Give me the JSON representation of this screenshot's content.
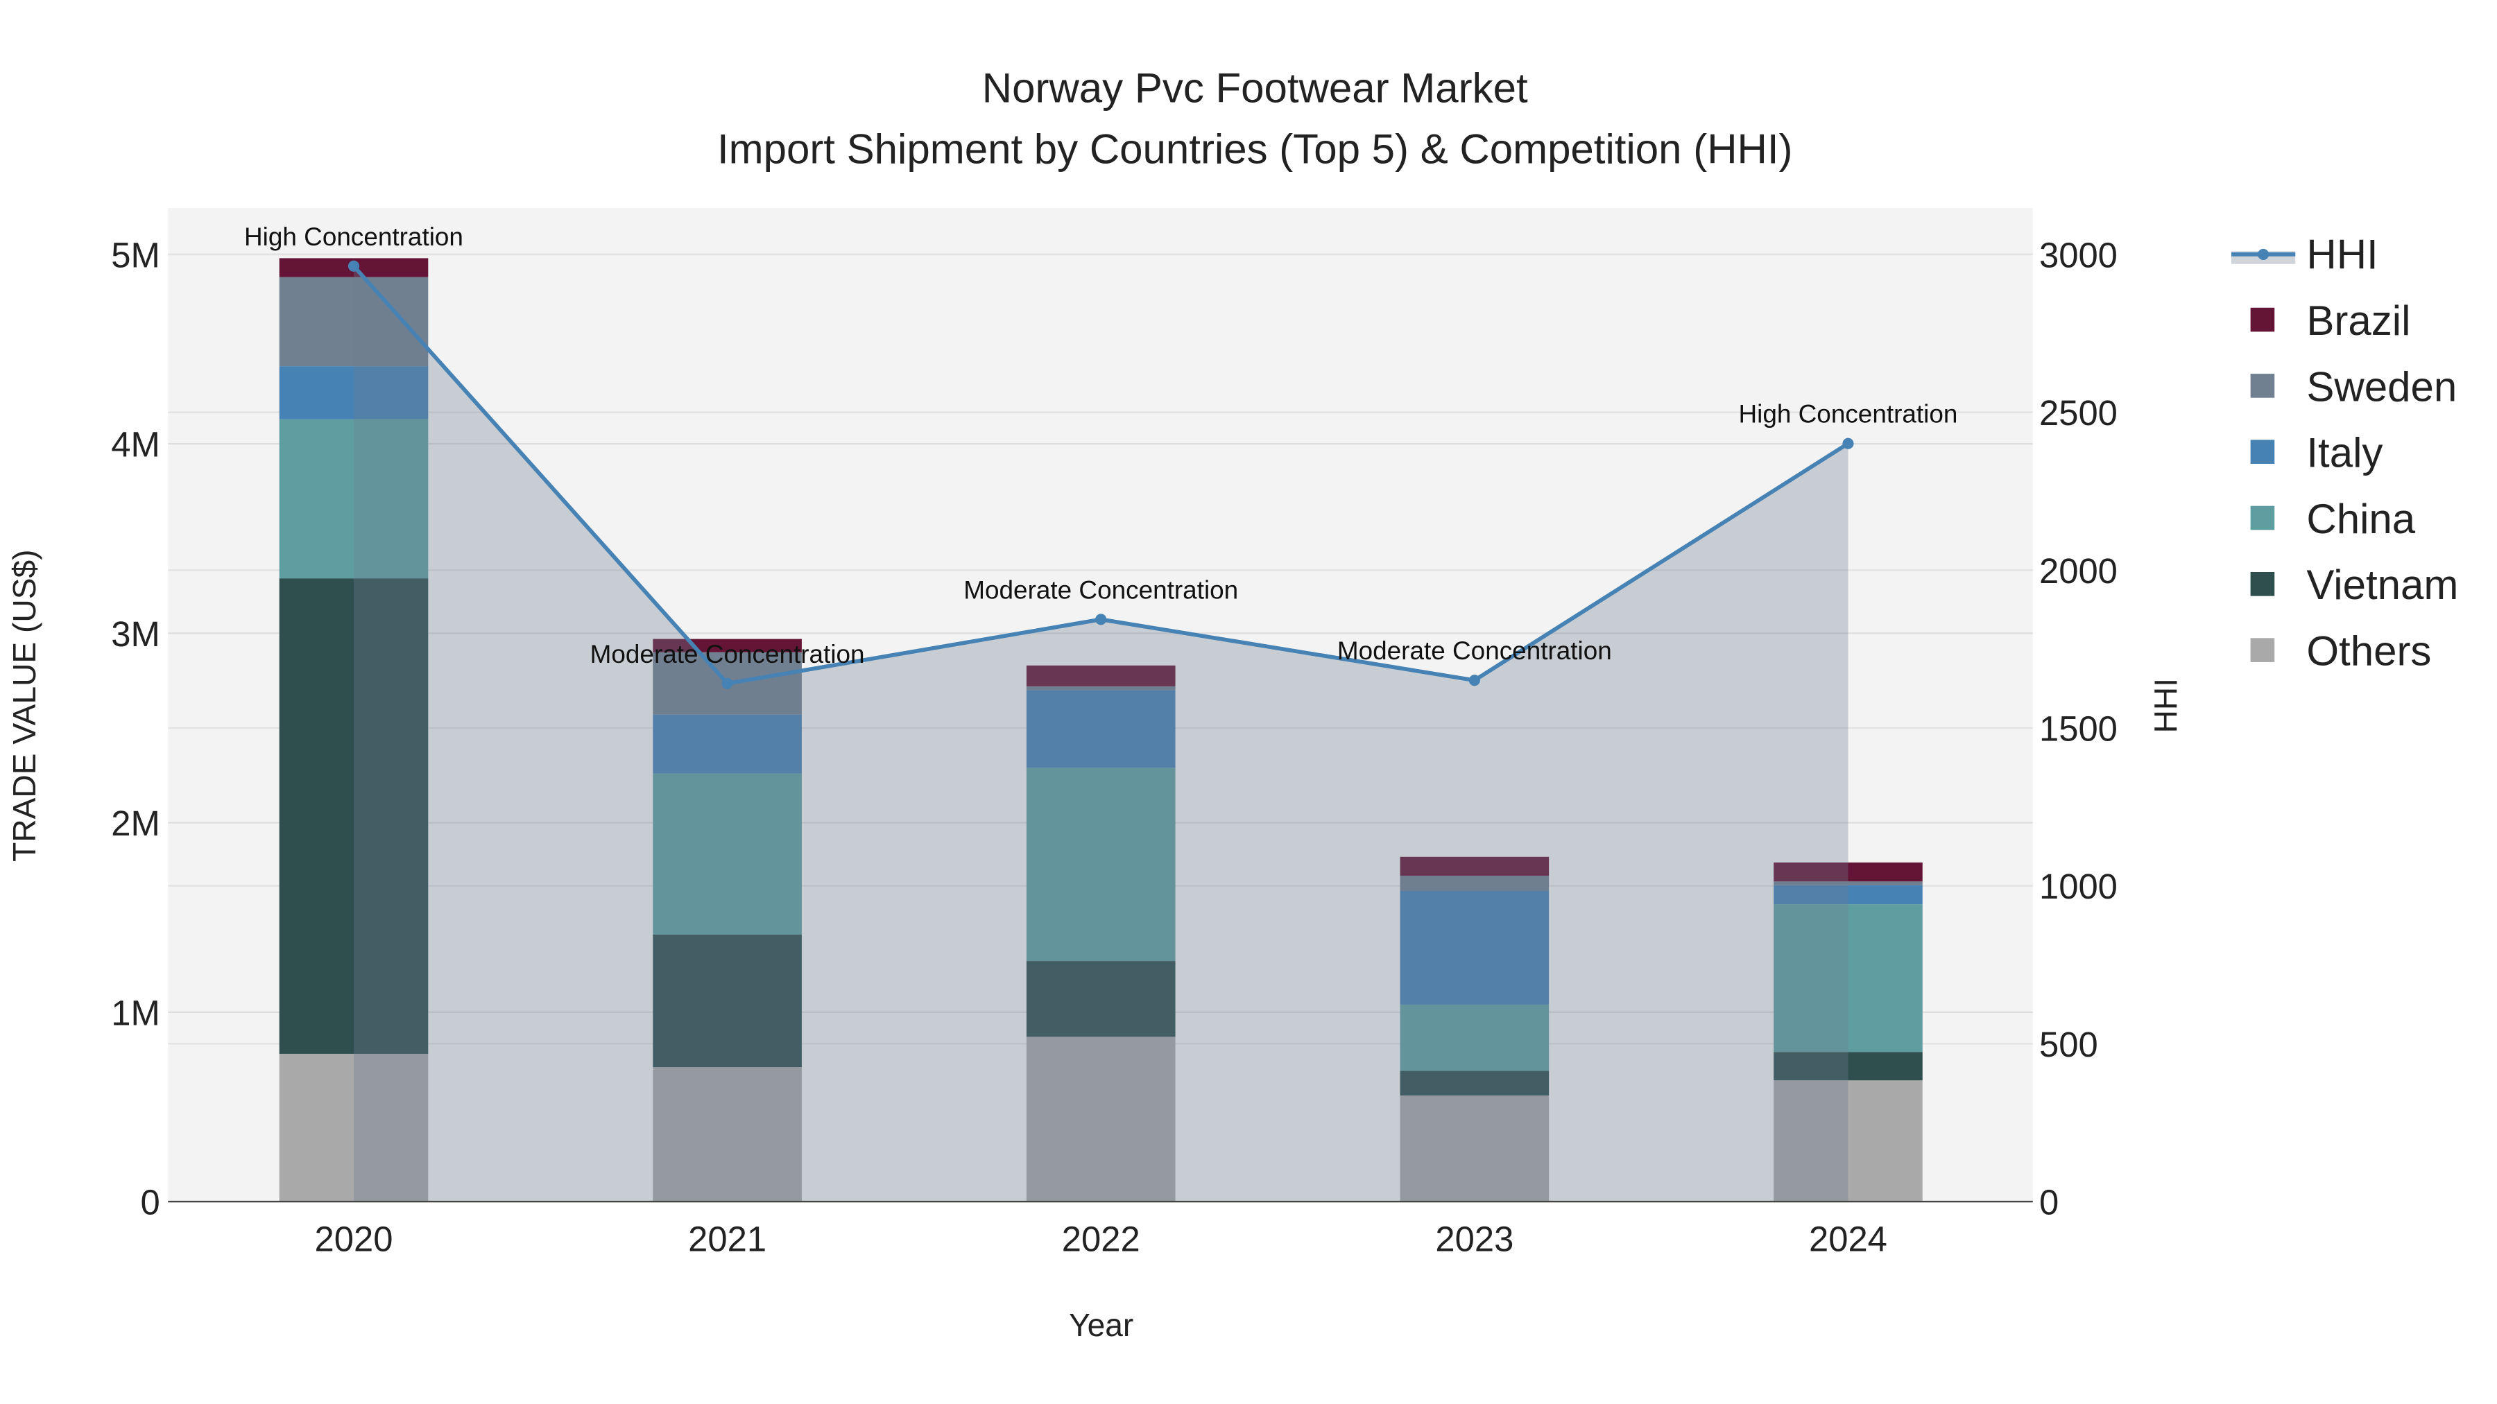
{
  "chart_data": {
    "type": "bar",
    "title_line1": "Norway Pvc Footwear Market",
    "title_line2": "Import Shipment by Countries (Top 5) & Competition (HHI)",
    "xlabel": "Year",
    "ylabel": "TRADE VALUE (US$)",
    "y2label": "HHI",
    "categories": [
      "2020",
      "2021",
      "2022",
      "2023",
      "2024"
    ],
    "ylim": [
      0,
      5000000
    ],
    "y_ticks": [
      0,
      1000000,
      2000000,
      3000000,
      4000000,
      5000000
    ],
    "y_tick_labels": [
      "0",
      "1M",
      "2M",
      "3M",
      "4M",
      "5M"
    ],
    "y2lim": [
      0,
      3000
    ],
    "y2_ticks": [
      0,
      500,
      1000,
      1500,
      2000,
      2500,
      3000
    ],
    "y2_tick_labels": [
      "0",
      "500",
      "1000",
      "1500",
      "2000",
      "2500",
      "3000"
    ],
    "grid": true,
    "legend_position": "right",
    "series": [
      {
        "name": "Others",
        "color": "#a9a9a9",
        "values": [
          780000,
          710000,
          870000,
          560000,
          640000
        ]
      },
      {
        "name": "Vietnam",
        "color": "#2f4f4f",
        "values": [
          2510000,
          700000,
          400000,
          130000,
          150000
        ]
      },
      {
        "name": "China",
        "color": "#5f9ea0",
        "values": [
          840000,
          850000,
          1020000,
          350000,
          780000
        ]
      },
      {
        "name": "Italy",
        "color": "#4682b4",
        "values": [
          280000,
          310000,
          410000,
          600000,
          100000
        ]
      },
      {
        "name": "Sweden",
        "color": "#708090",
        "values": [
          470000,
          330000,
          20000,
          80000,
          20000
        ]
      },
      {
        "name": "Brazil",
        "color": "#641536",
        "values": [
          100000,
          70000,
          110000,
          100000,
          100000
        ]
      }
    ],
    "hhi": {
      "name": "HHI",
      "color": "#4682b4",
      "values": [
        2963,
        1641,
        1844,
        1651,
        2401
      ],
      "annotations": [
        "High Concentration",
        "Moderate Concentration",
        "Moderate Concentration",
        "Moderate Concentration",
        "High Concentration"
      ]
    },
    "legend": [
      "HHI",
      "Brazil",
      "Sweden",
      "Italy",
      "China",
      "Vietnam",
      "Others"
    ]
  }
}
